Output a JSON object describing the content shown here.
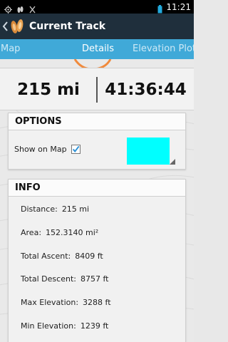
{
  "status_bar": {
    "time": "11:21",
    "icons_left": [
      "gps-icon",
      "app-feet-icon",
      "usb-debug-icon"
    ],
    "icons_right": [
      "battery-icon",
      "wifi-icon",
      "signal-icon"
    ]
  },
  "action_bar": {
    "title": "Current Track"
  },
  "tabs": [
    {
      "label": "Map"
    },
    {
      "label": "Details"
    },
    {
      "label": "Elevation Plot"
    }
  ],
  "stats": {
    "distance": "215 mi",
    "duration": "41:36:44"
  },
  "options": {
    "header": "OPTIONS",
    "show_on_map_label": "Show on Map",
    "show_on_map_checked": true,
    "track_color": "#00ffff"
  },
  "info": {
    "header": "INFO",
    "items": [
      {
        "label": "Distance:",
        "value": "215 mi"
      },
      {
        "label": "Area:",
        "value": "152.3140 mi²"
      },
      {
        "label": "Total Ascent:",
        "value": "8409 ft"
      },
      {
        "label": "Total Descent:",
        "value": "8757 ft"
      },
      {
        "label": "Max Elevation:",
        "value": "3288 ft"
      },
      {
        "label": "Min Elevation:",
        "value": "1239 ft"
      }
    ]
  }
}
